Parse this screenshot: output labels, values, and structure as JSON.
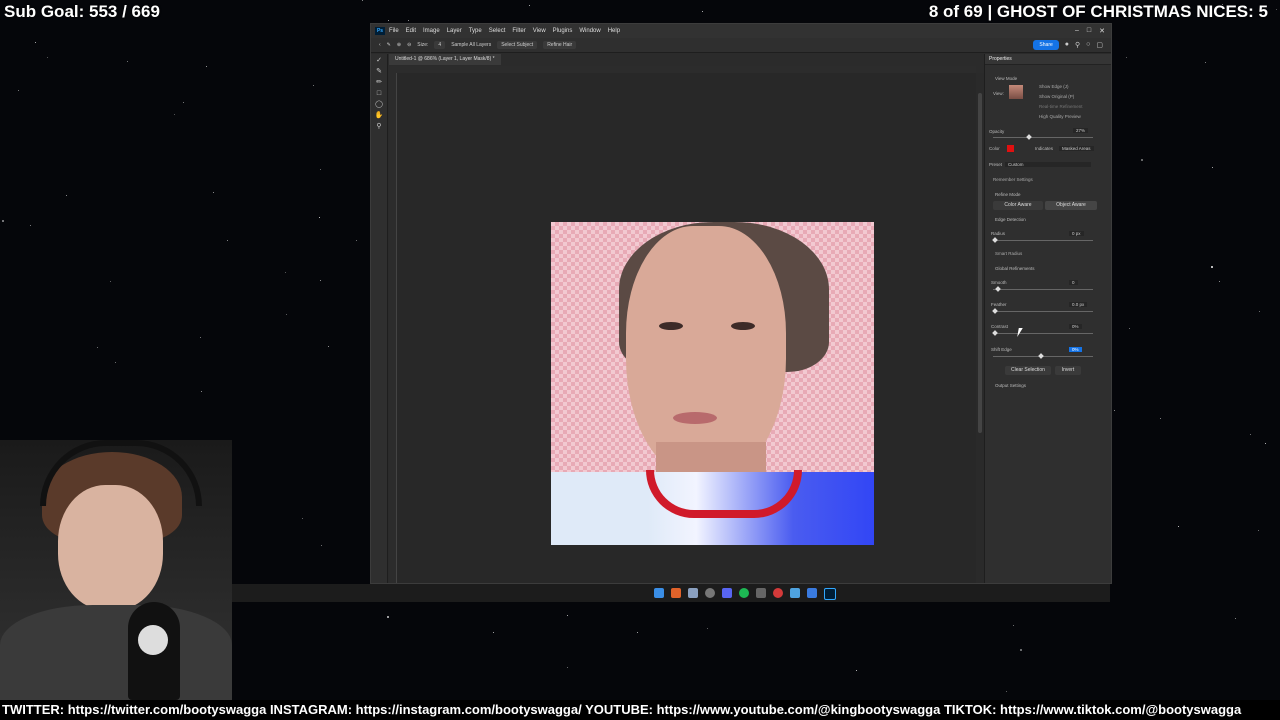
{
  "overlay": {
    "sub_goal": "Sub Goal: 553 / 669",
    "ghost": "8 of 69 | GHOST OF CHRISTMAS NICES: 5",
    "ticker": "TWITTER: https://twitter.com/bootyswagga INSTAGRAM: https://instagram.com/bootyswagga/ YOUTUBE: https://www.youtube.com/@kingbootyswagga TIKTOK: https://www.tiktok.com/@bootyswagga"
  },
  "photoshop": {
    "logo": "Ps",
    "menu": [
      "File",
      "Edit",
      "Image",
      "Layer",
      "Type",
      "Select",
      "Filter",
      "View",
      "Plugins",
      "Window",
      "Help"
    ],
    "options": {
      "size_label": "Size:",
      "size_value": "4",
      "sample_all_layers": "Sample All Layers",
      "select_subject": "Select Subject",
      "refine_hair": "Refine Hair",
      "share": "Share"
    },
    "doc_tab": "Untitled-1 @ 686% (Layer 1, Layer Mask/8) *",
    "properties": {
      "title": "Properties",
      "view_mode": "View Mode",
      "view": "View:",
      "show_edge": "Show Edge (J)",
      "show_original": "Show Original (P)",
      "realtime_refinement": "Real-time Refinement",
      "high_quality_preview": "High Quality Preview",
      "opacity_label": "Opacity",
      "opacity_value": "27%",
      "color_label": "Color",
      "indicates_label": "Indicates",
      "indicates_value": "Masked Areas",
      "preset_label": "Preset",
      "preset_value": "Custom",
      "remember_settings": "Remember Settings",
      "refine_mode": "Refine Mode",
      "color_aware": "Color Aware",
      "object_aware": "Object Aware",
      "edge_detection": "Edge Detection",
      "radius_label": "Radius",
      "radius_value": "0 px",
      "smart_radius": "Smart Radius",
      "global_refinements": "Global Refinements",
      "smooth_label": "Smooth",
      "smooth_value": "0",
      "feather_label": "Feather",
      "feather_value": "0.0 px",
      "contrast_label": "Contrast",
      "contrast_value": "0%",
      "shift_edge_label": "Shift Edge",
      "shift_edge_value": "0%",
      "clear_selection": "Clear Selection",
      "invert": "Invert",
      "output_settings": "Output Settings"
    }
  },
  "colors": {
    "ps_accent": "#1473e6",
    "mask_color": "#e01010"
  },
  "icons": [
    "close-icon",
    "maximize-icon",
    "minimize-icon",
    "search-icon",
    "gear-icon",
    "bell-icon",
    "brush-icon",
    "zoom-icon",
    "hand-icon",
    "lasso-icon"
  ]
}
